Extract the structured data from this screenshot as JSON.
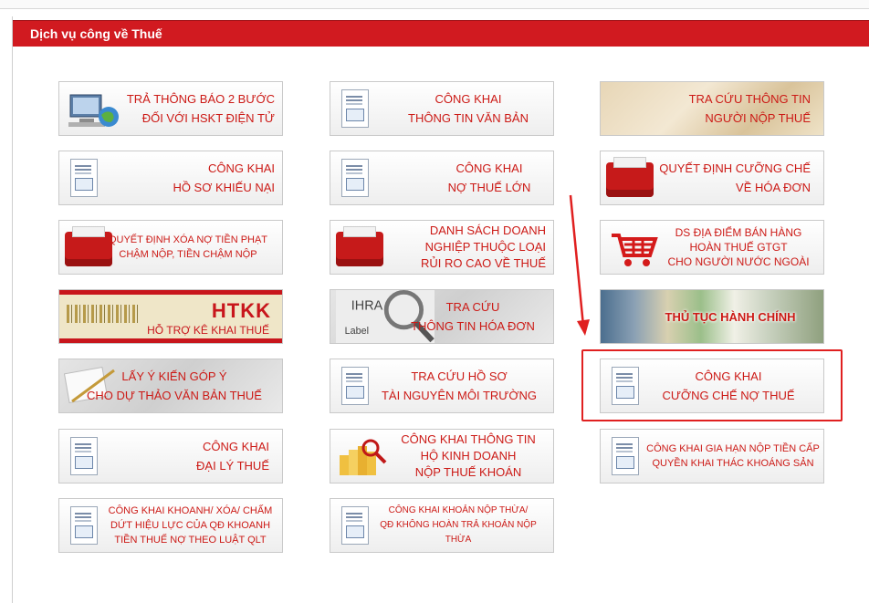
{
  "header": {
    "title": "Dịch vụ công về Thuế"
  },
  "tiles": {
    "t1": [
      "TRẢ THÔNG BÁO 2 BƯỚC",
      "ĐỐI VỚI HSKT ĐIỆN TỬ"
    ],
    "t2": [
      "CÔNG KHAI",
      "THÔNG TIN VĂN BẢN"
    ],
    "t3": [
      "TRA CỨU THÔNG TIN",
      "NGƯỜI NỘP THUẾ"
    ],
    "t4": [
      "CÔNG KHAI",
      "HỒ SƠ KHIẾU NẠI"
    ],
    "t5": [
      "CÔNG KHAI",
      "NỢ THUẾ LỚN"
    ],
    "t6": [
      "QUYẾT ĐỊNH CƯỠNG CHẾ",
      "VỀ HÓA ĐƠN"
    ],
    "t7": [
      "QUYẾT ĐỊNH XÓA NỢ TIỀN PHẠT",
      "CHẬM NỘP, TIỀN CHẬM NỘP"
    ],
    "t8": [
      "DANH SÁCH DOANH",
      "NGHIỆP THUỘC LOẠI",
      "RỦI RO CAO VỀ THUẾ"
    ],
    "t9": [
      "DS ĐỊA ĐIỂM BÁN HÀNG",
      "HOÀN THUẾ GTGT",
      "CHO NGƯỜI NƯỚC NGOÀI"
    ],
    "t10": {
      "big": "HTKK",
      "small": "HỖ TRỢ KÊ KHAI THUẾ"
    },
    "t11": [
      "TRA CỨU",
      "THÔNG TIN HÓA ĐƠN"
    ],
    "t12": [
      "THỦ TỤC HÀNH CHÍNH"
    ],
    "t13": [
      "LẤY Ý KIẾN GÓP Ý",
      "CHO DỰ THẢO VĂN BẢN THUẾ"
    ],
    "t14": [
      "TRA CỨU HỒ SƠ",
      "TÀI NGUYÊN MÔI TRƯỜNG"
    ],
    "t15": [
      "CÔNG KHAI",
      "CƯỠNG CHẾ NỢ THUẾ"
    ],
    "t16": [
      "CÔNG KHAI",
      "ĐẠI LÝ THUẾ"
    ],
    "t17": [
      "CÔNG KHAI THÔNG TIN",
      "HỘ KINH DOANH",
      "NỘP THUẾ KHOÁN"
    ],
    "t18": [
      "CÔNG KHAI GIA HẠN NỘP TIỀN CẤP",
      "QUYỀN KHAI THÁC KHOÁNG SẢN"
    ],
    "t19": [
      "CÔNG KHAI KHOANH/ XÓA/ CHẤM",
      "DỨT HIỆU LỰC CỦA QĐ KHOANH",
      "TIỀN THUẾ NỢ THEO LUẬT QLT"
    ],
    "t20": [
      "CÔNG KHAI KHOẢN NỘP THỪA/",
      "QĐ KHÔNG HOÀN TRẢ KHOẢN NỘP THỪA"
    ]
  },
  "colors": {
    "header": "#d11a20",
    "tile_text": "#cc1a16",
    "highlight": "#e02020"
  }
}
